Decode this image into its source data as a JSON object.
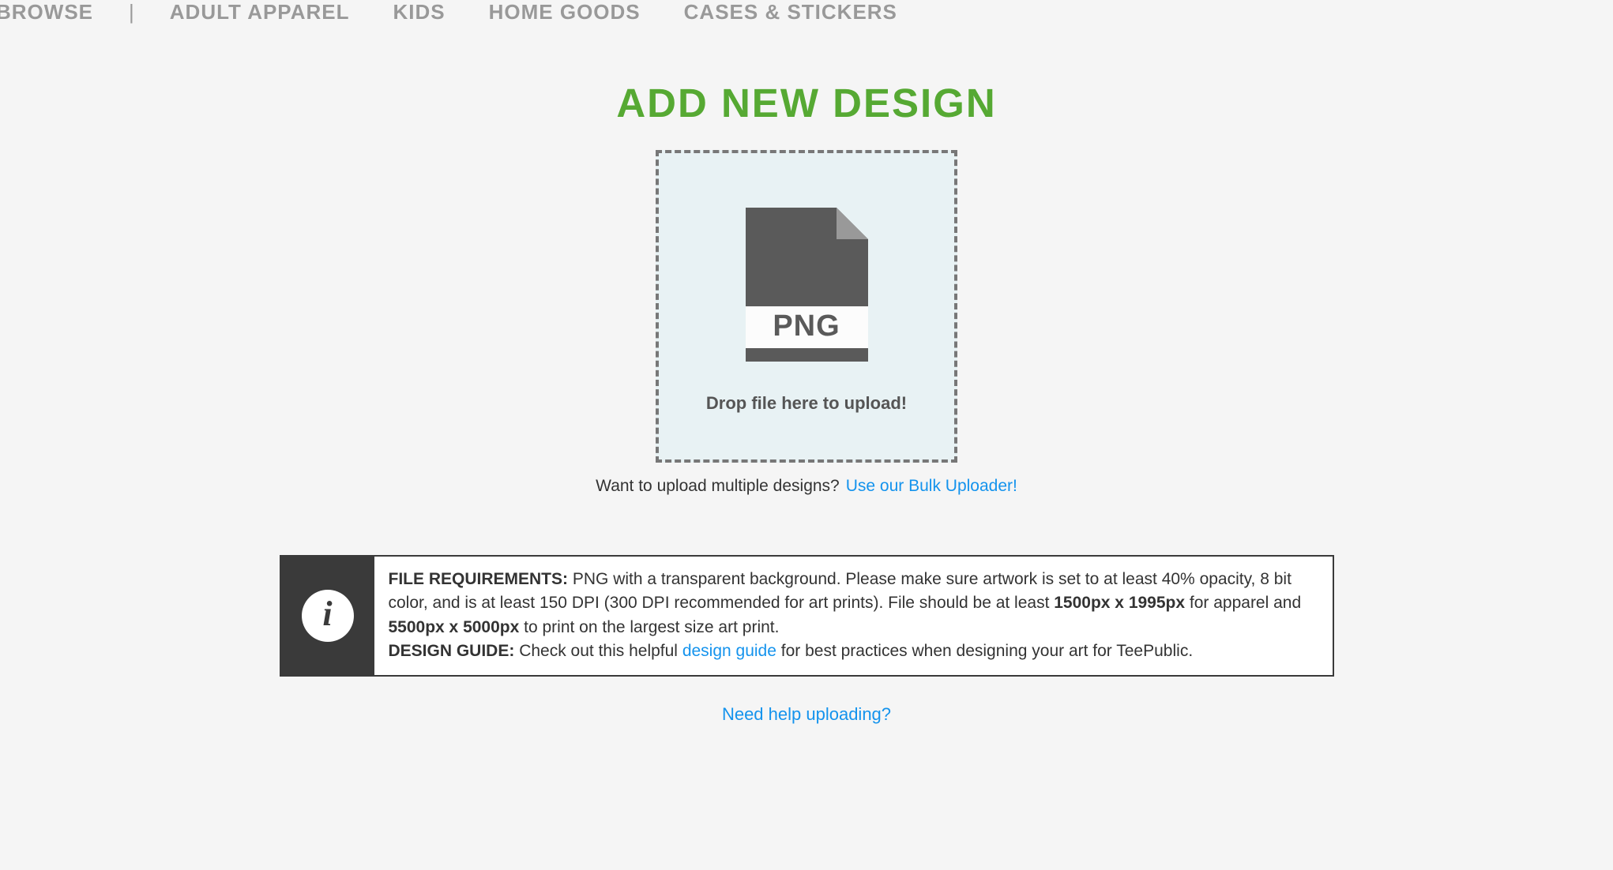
{
  "nav": {
    "items": [
      "BROWSE",
      "ADULT APPAREL",
      "KIDS",
      "HOME GOODS",
      "CASES & STICKERS"
    ],
    "separator": "|"
  },
  "page": {
    "title": "ADD NEW DESIGN"
  },
  "dropzone": {
    "file_badge": "PNG",
    "prompt": "Drop file here to upload!"
  },
  "bulk": {
    "prompt": "Want to upload multiple designs?",
    "link": "Use our Bulk Uploader!"
  },
  "info": {
    "icon_letter": "i",
    "req_label": "FILE REQUIREMENTS:",
    "req_text_1": " PNG with a transparent background. Please make sure artwork is set to at least 40% opacity, 8 bit color, and is at least 150 DPI (300 DPI recommended for art prints). File should be at least ",
    "req_dim_1": "1500px x 1995px",
    "req_text_2": " for apparel and ",
    "req_dim_2": "5500px x 5000px",
    "req_text_3": " to print on the largest size art print.",
    "guide_label": "DESIGN GUIDE:",
    "guide_text_1": " Check out this helpful ",
    "guide_link": "design guide",
    "guide_text_2": " for best practices when designing your art for TeePublic."
  },
  "help": {
    "link": "Need help uploading?"
  }
}
